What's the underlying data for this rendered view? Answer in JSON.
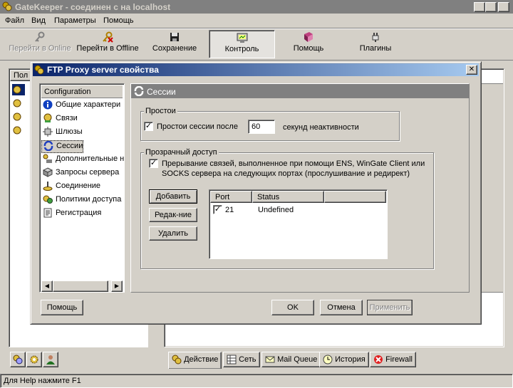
{
  "main_window": {
    "title": "GateKeeper - соединен с на localhost",
    "controls": {
      "minimize": "_",
      "maximize": "□",
      "close": "✕"
    }
  },
  "menu": [
    "Файл",
    "Вид",
    "Параметры",
    "Помощь"
  ],
  "toolbar": [
    {
      "label": "Перейти в Online",
      "icon": "key-icon",
      "disabled": true
    },
    {
      "label": "Перейти в Offline",
      "icon": "key-cross-icon",
      "disabled": false
    },
    {
      "label": "Сохранение",
      "icon": "floppy-icon",
      "disabled": false
    },
    {
      "label": "Контроль",
      "icon": "monitor-icon",
      "disabled": false,
      "pressed": true
    },
    {
      "label": "Помощь",
      "icon": "book-icon",
      "disabled": false
    },
    {
      "label": "Плагины",
      "icon": "plug-icon",
      "disabled": false
    }
  ],
  "left_panel": {
    "header": "Пол"
  },
  "bottom_tabs": [
    "Действие",
    "Сеть",
    "Mail Queue",
    "История",
    "Firewall"
  ],
  "status_bar": "Для Help нажмите F1",
  "dialog": {
    "title": "FTP Proxy server свойства",
    "close": "✕",
    "tree_header": "Configuration",
    "tree_items": [
      {
        "label": "Общие характери",
        "icon": "info-icon"
      },
      {
        "label": "Связи",
        "icon": "bindings-icon"
      },
      {
        "label": "Шлюзы",
        "icon": "gateway-icon"
      },
      {
        "label": "Сессии",
        "icon": "sessions-icon",
        "selected": true
      },
      {
        "label": "Дополнительные н",
        "icon": "advanced-icon"
      },
      {
        "label": "Запросы сервера",
        "icon": "cube-icon"
      },
      {
        "label": "Соединение",
        "icon": "connection-icon"
      },
      {
        "label": "Политики доступа",
        "icon": "policy-icon"
      },
      {
        "label": "Регистрация",
        "icon": "document-icon"
      }
    ],
    "section_title": "Сессии",
    "timeouts": {
      "legend": "Простои",
      "checkbox_label": "Простои сессии после",
      "checked": true,
      "value": "60",
      "suffix": "секунд неактивности"
    },
    "transparent": {
      "legend": "Прозрачный доступ",
      "checkbox_label_line1": "Прерывание связей, выполненное при помощи ENS, WinGate Client или",
      "checkbox_label_line2": "SOCKS сервера на следующих портах (прослушивание и редирект)",
      "checked": true,
      "buttons": {
        "add": "Добавить",
        "edit": "Редак-ние",
        "delete": "Удалить"
      },
      "columns": [
        "Port",
        "Status"
      ],
      "rows": [
        {
          "port": "21",
          "status": "Undefined",
          "checked": true
        }
      ]
    },
    "buttons": {
      "help": "Помощь",
      "ok": "OK",
      "cancel": "Отмена",
      "apply": "Применить"
    }
  }
}
